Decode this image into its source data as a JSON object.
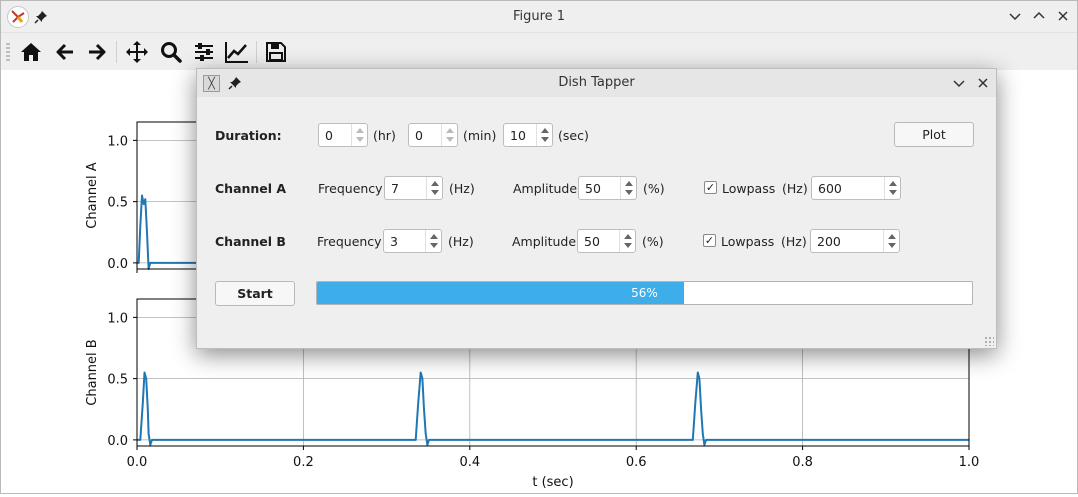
{
  "figure": {
    "title": "Figure 1",
    "toolbar": [
      "home-icon",
      "back-icon",
      "forward-icon",
      "pan-icon",
      "zoom-icon",
      "configure-subplots-icon",
      "edit-axes-icon",
      "save-icon"
    ]
  },
  "chart_data": [
    {
      "type": "line",
      "ylabel": "Channel A",
      "yticks": [
        "0.0",
        "0.5",
        "1.0"
      ],
      "ylim": [
        -0.05,
        1.15
      ],
      "xlim": [
        0,
        1
      ],
      "grid": true,
      "series": [
        {
          "x": [
            0,
            0.002,
            0.004,
            0.006,
            0.008,
            0.01,
            0.012,
            0.014,
            0.016,
            0.018,
            0.02,
            1.0
          ],
          "y": [
            0,
            0,
            0.3,
            0.55,
            0.48,
            0.52,
            0.25,
            -0.05,
            0,
            0,
            0,
            0
          ]
        }
      ]
    },
    {
      "type": "line",
      "ylabel": "Channel B",
      "xlabel": "t (sec)",
      "yticks": [
        "0.0",
        "0.5",
        "1.0"
      ],
      "xticks": [
        "0.0",
        "0.2",
        "0.4",
        "0.6",
        "0.8",
        "1.0"
      ],
      "ylim": [
        -0.05,
        1.15
      ],
      "xlim": [
        0,
        1
      ],
      "grid": true,
      "series": [
        {
          "x": [
            0,
            0.004,
            0.007,
            0.009,
            0.011,
            0.013,
            0.014,
            0.016,
            0.018,
            0.02,
            0.335,
            0.338,
            0.341,
            0.343,
            0.345,
            0.347,
            0.349,
            0.351,
            0.353,
            0.668,
            0.671,
            0.674,
            0.676,
            0.678,
            0.68,
            0.682,
            0.684,
            0.686,
            1.0
          ],
          "y": [
            0,
            0,
            0.3,
            0.55,
            0.5,
            0.25,
            0.05,
            -0.04,
            0,
            0,
            0,
            0.3,
            0.55,
            0.5,
            0.25,
            0.05,
            -0.04,
            0,
            0,
            0,
            0.3,
            0.55,
            0.5,
            0.25,
            0.05,
            -0.04,
            0,
            0,
            0
          ]
        }
      ]
    }
  ],
  "dialog": {
    "title": "Dish Tapper",
    "duration": {
      "label": "Duration:",
      "hr_value": "0",
      "hr_unit": "(hr)",
      "min_value": "0",
      "min_unit": "(min)",
      "sec_value": "10",
      "sec_unit": "(sec)"
    },
    "plot_button": "Plot",
    "channel_a": {
      "label": "Channel A",
      "freq_label": "Frequency",
      "freq_value": "7",
      "freq_unit": "(Hz)",
      "amp_label": "Amplitude",
      "amp_value": "50",
      "amp_unit": "(%)",
      "lowpass_label": "Lowpass",
      "lowpass_checked": true,
      "lowpass_unit": "(Hz)",
      "lowpass_value": "600"
    },
    "channel_b": {
      "label": "Channel B",
      "freq_label": "Frequency",
      "freq_value": "3",
      "freq_unit": "(Hz)",
      "amp_label": "Amplitude",
      "amp_value": "50",
      "amp_unit": "(%)",
      "lowpass_label": "Lowpass",
      "lowpass_checked": true,
      "lowpass_unit": "(Hz)",
      "lowpass_value": "200"
    },
    "start_button": "Start",
    "progress": {
      "value": 56,
      "text": "56%"
    }
  },
  "colors": {
    "line": "#1f77b4",
    "progress": "#3daee9",
    "grid": "#b0b0b0"
  }
}
